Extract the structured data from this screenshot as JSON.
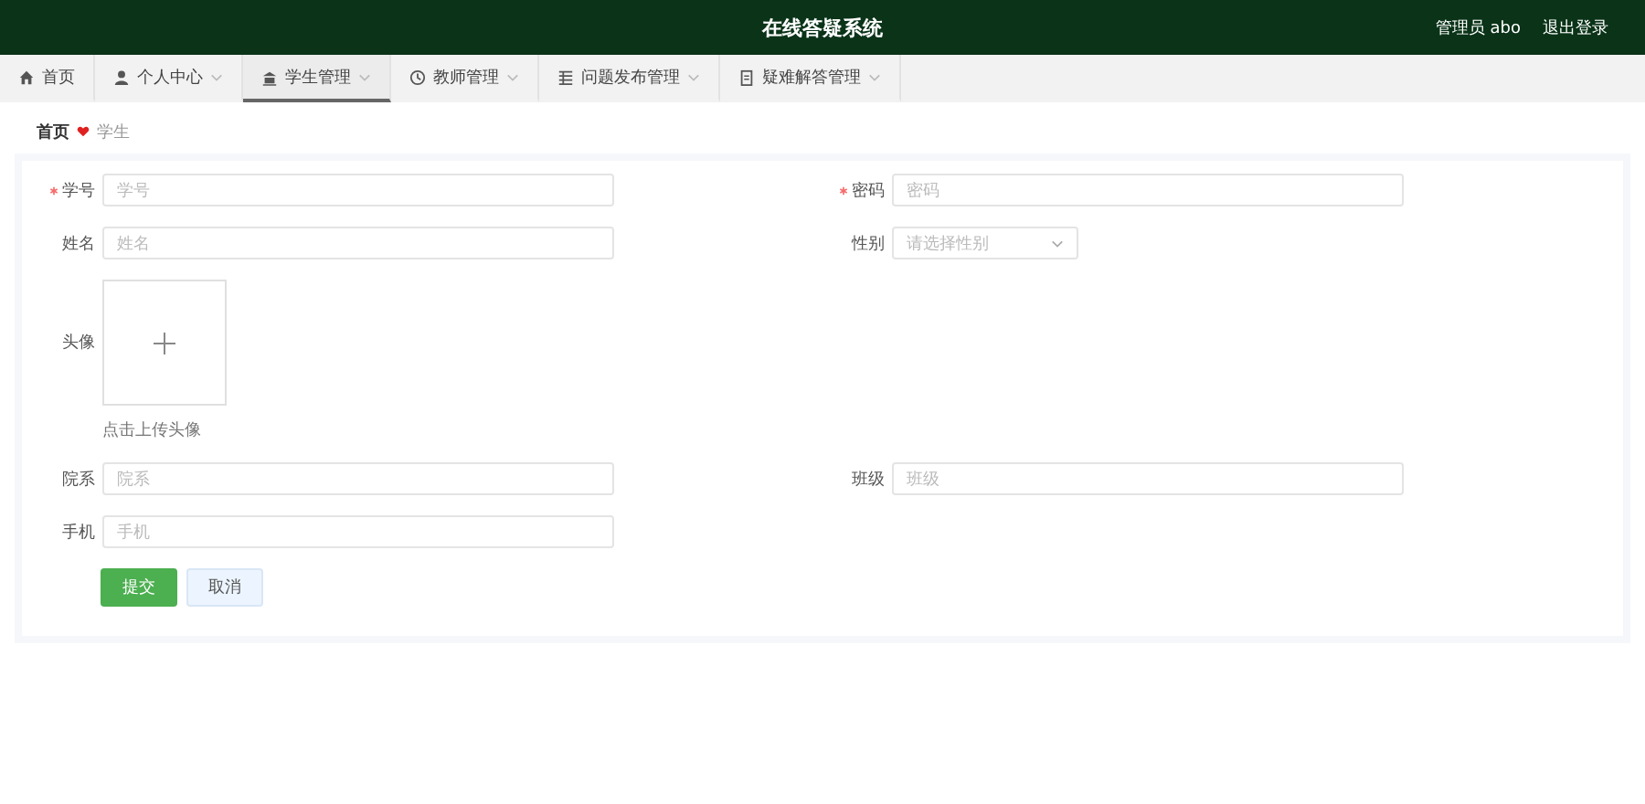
{
  "header": {
    "title": "在线答疑系统",
    "user": "管理员 abo",
    "logout": "退出登录"
  },
  "tabs": [
    {
      "label": "首页",
      "kind": "home",
      "dropdown": false,
      "selected": false
    },
    {
      "label": "个人中心",
      "kind": "user",
      "dropdown": true,
      "selected": false
    },
    {
      "label": "学生管理",
      "kind": "building",
      "dropdown": true,
      "selected": true
    },
    {
      "label": "教师管理",
      "kind": "clock",
      "dropdown": true,
      "selected": false
    },
    {
      "label": "问题发布管理",
      "kind": "list",
      "dropdown": true,
      "selected": false
    },
    {
      "label": "疑难解答管理",
      "kind": "document",
      "dropdown": true,
      "selected": false
    }
  ],
  "breadcrumb": [
    {
      "label": "首页"
    },
    {
      "label": "学生"
    }
  ],
  "form": {
    "fields": [
      {
        "kind": "input",
        "label": "学号",
        "required": true,
        "placeholder": "学号"
      },
      {
        "kind": "input",
        "label": "密码",
        "required": true,
        "placeholder": "密码"
      },
      {
        "kind": "input",
        "label": "姓名",
        "required": false,
        "placeholder": "姓名"
      },
      {
        "kind": "select",
        "label": "性别",
        "required": false,
        "placeholder": "请选择性别"
      },
      {
        "kind": "upload",
        "label": "头像",
        "required": false,
        "hint": "点击上传头像"
      },
      {
        "kind": "input",
        "label": "院系",
        "required": false,
        "placeholder": "院系"
      },
      {
        "kind": "input",
        "label": "班级",
        "required": false,
        "placeholder": "班级"
      },
      {
        "kind": "input",
        "label": "手机",
        "required": false,
        "placeholder": "手机"
      }
    ],
    "buttons": [
      {
        "label": "提交",
        "kind": "primary"
      },
      {
        "label": "取消",
        "kind": "secondary"
      }
    ]
  }
}
